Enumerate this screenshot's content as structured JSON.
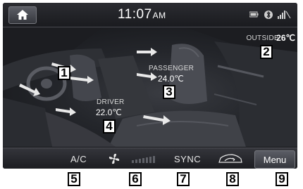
{
  "status": {
    "time": "11:07",
    "ampm": "AM"
  },
  "climate": {
    "outside_label": "OUTSIDE",
    "outside_temp": "26℃",
    "passenger_label": "PASSENGER",
    "passenger_temp": "24.0℃",
    "driver_label": "DRIVER",
    "driver_temp": "22.0℃"
  },
  "bottom": {
    "ac_label": "A/C",
    "sync_label": "SYNC",
    "menu_label": "Menu",
    "fan_level": 0
  },
  "callouts": [
    "1",
    "2",
    "3",
    "4",
    "5",
    "6",
    "7",
    "8",
    "9"
  ],
  "icons": [
    "home-icon",
    "battery-icon",
    "bluetooth-icon",
    "signal-icon",
    "fan-icon",
    "recirculation-icon"
  ]
}
